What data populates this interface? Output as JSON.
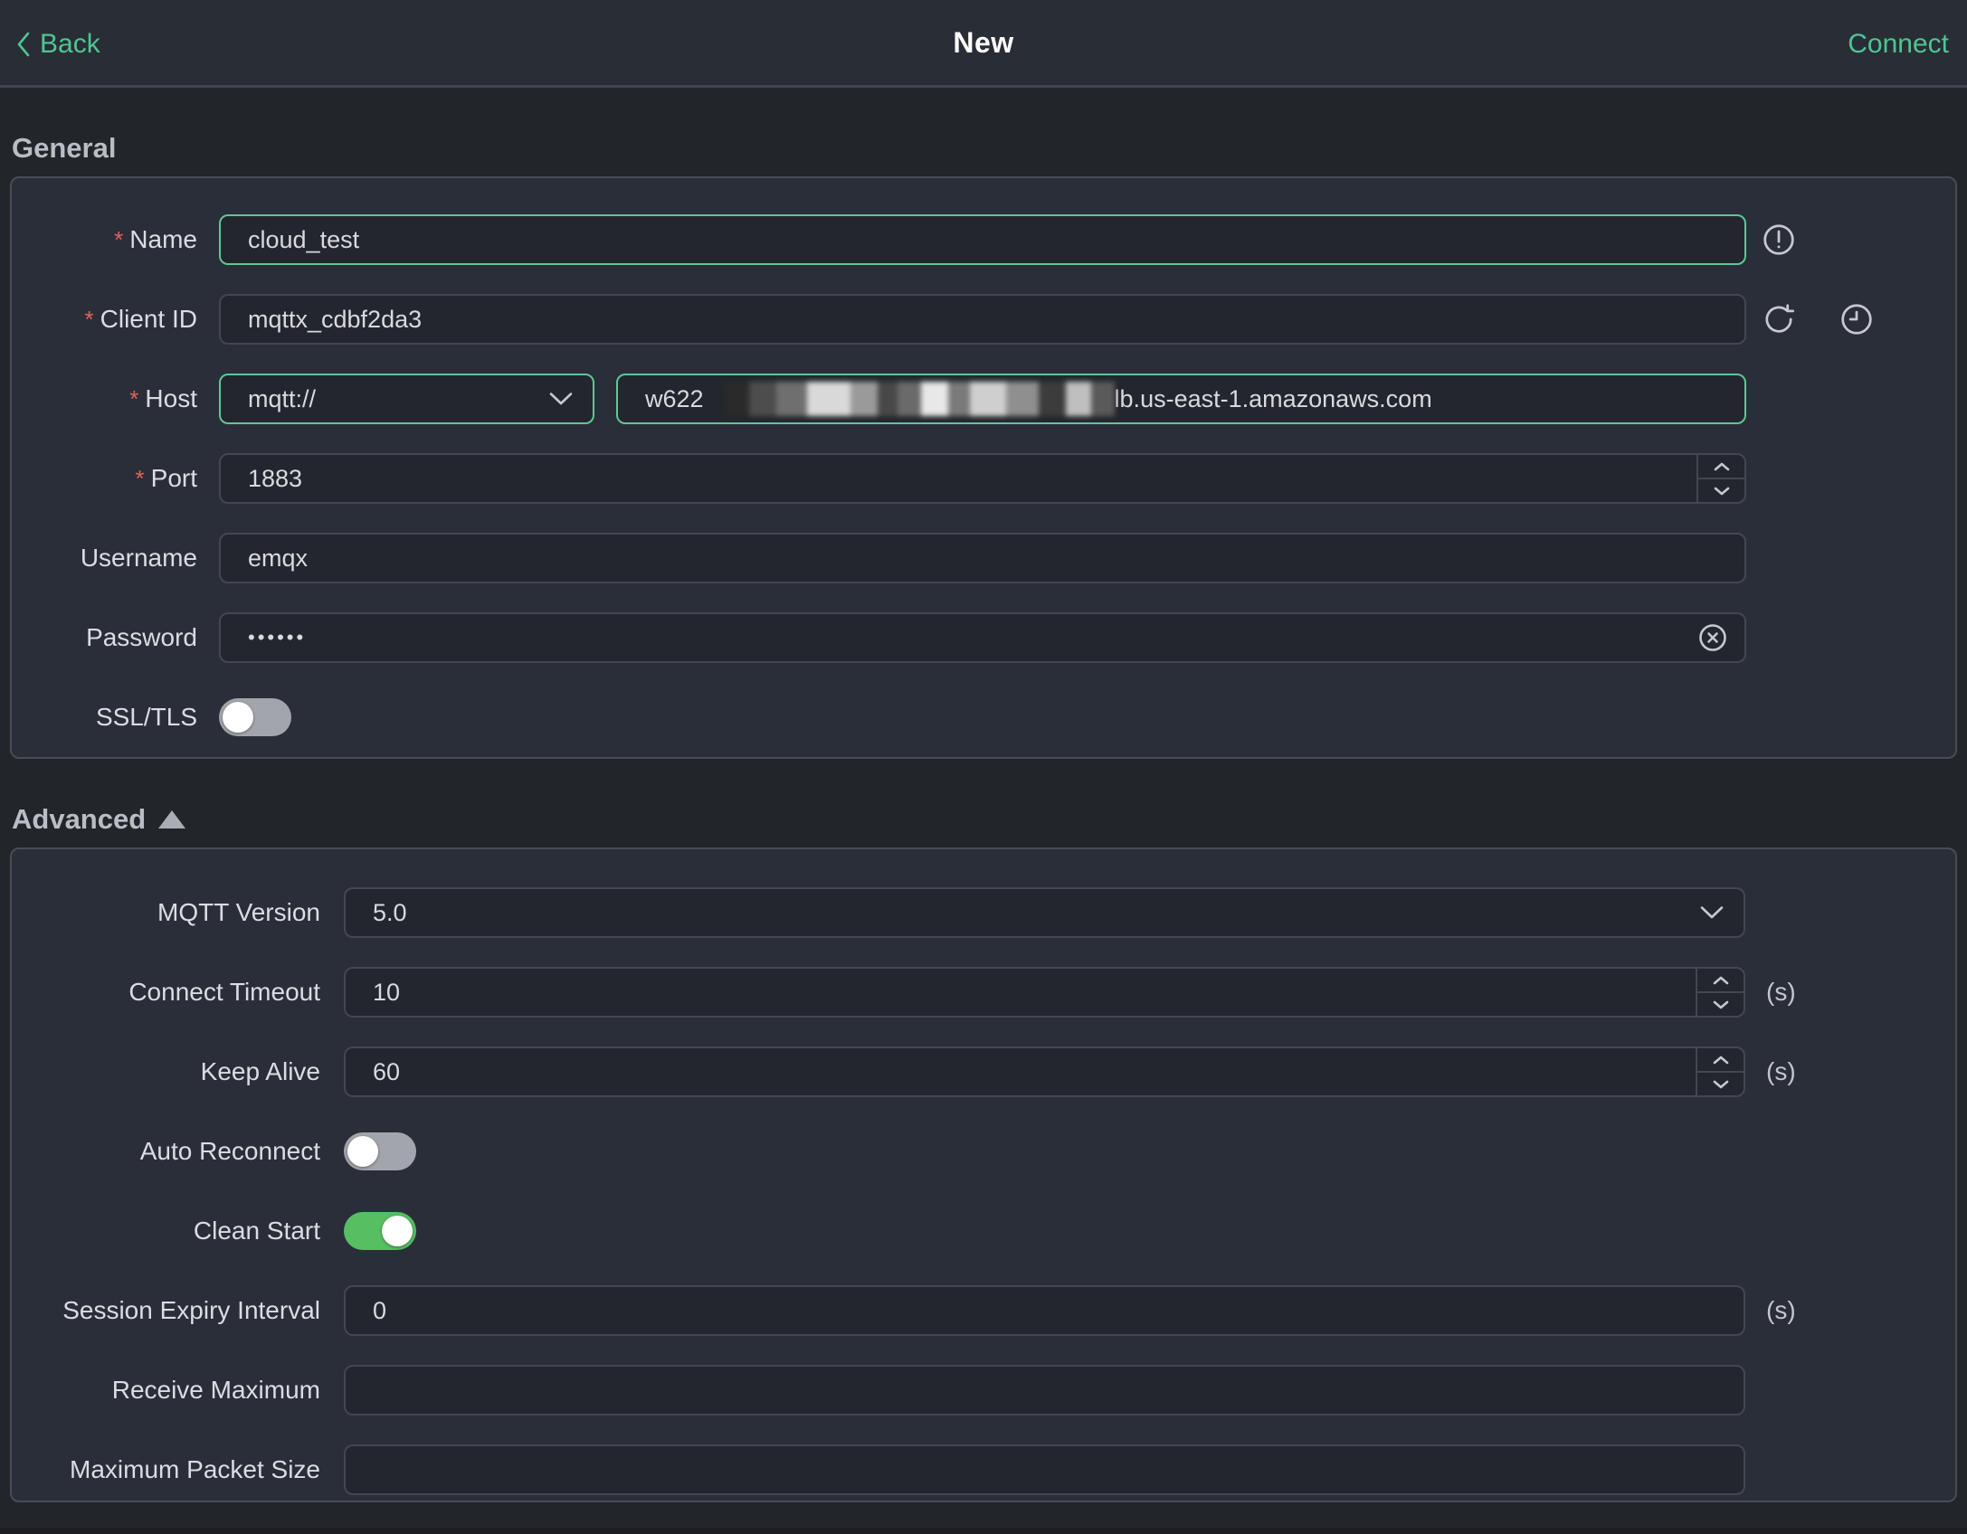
{
  "topbar": {
    "back": "Back",
    "title": "New",
    "connect": "Connect"
  },
  "general": {
    "heading": "General",
    "required_marker": "*",
    "name_label": "Name",
    "name_value": "cloud_test",
    "client_id_label": "Client ID",
    "client_id_value": "mqttx_cdbf2da3",
    "host_label": "Host",
    "host_protocol": "mqtt://",
    "host_prefix": "w622",
    "host_suffix": "lb.us-east-1.amazonaws.com",
    "port_label": "Port",
    "port_value": "1883",
    "username_label": "Username",
    "username_value": "emqx",
    "password_label": "Password",
    "password_value": "••••••",
    "ssl_label": "SSL/TLS",
    "ssl_on": false
  },
  "advanced": {
    "heading": "Advanced",
    "mqtt_version_label": "MQTT Version",
    "mqtt_version_value": "5.0",
    "connect_timeout_label": "Connect Timeout",
    "connect_timeout_value": "10",
    "keep_alive_label": "Keep Alive",
    "keep_alive_value": "60",
    "auto_reconnect_label": "Auto Reconnect",
    "auto_reconnect_on": false,
    "clean_start_label": "Clean Start",
    "clean_start_on": true,
    "session_expiry_label": "Session Expiry Interval",
    "session_expiry_value": "0",
    "receive_maximum_label": "Receive Maximum",
    "receive_maximum_value": "",
    "maximum_packet_size_label": "Maximum Packet Size",
    "maximum_packet_size_value": "",
    "seconds_unit": "(s)"
  },
  "colors": {
    "accent_green": "#4fc592",
    "input_focus_border": "#5ec796",
    "toggle_on_green": "#57bf62",
    "required_red": "#e2625b",
    "card_bg": "#2a2e38",
    "page_bg": "#222529"
  }
}
